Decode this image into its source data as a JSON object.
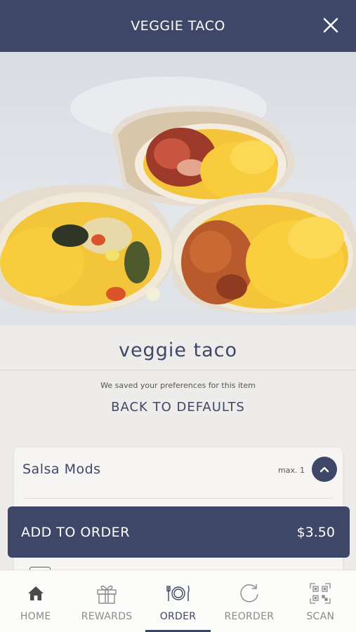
{
  "header": {
    "title": "VEGGIE TACO"
  },
  "item": {
    "title": "veggie taco",
    "saved_note": "We saved your preferences for this item",
    "defaults_label": "BACK TO DEFAULTS"
  },
  "modifier_group": {
    "title": "Salsa Mods",
    "max_label": "max. 1"
  },
  "order_button": {
    "label": "ADD TO ORDER",
    "price": "$3.50"
  },
  "tabs": [
    {
      "label": "HOME",
      "icon": "home-icon"
    },
    {
      "label": "REWARDS",
      "icon": "gift-icon"
    },
    {
      "label": "ORDER",
      "icon": "plate-icon",
      "active": true
    },
    {
      "label": "REORDER",
      "icon": "refresh-icon"
    },
    {
      "label": "SCAN",
      "icon": "qr-code-icon"
    }
  ],
  "colors": {
    "brand": "#3f4768",
    "background": "#edecea"
  }
}
